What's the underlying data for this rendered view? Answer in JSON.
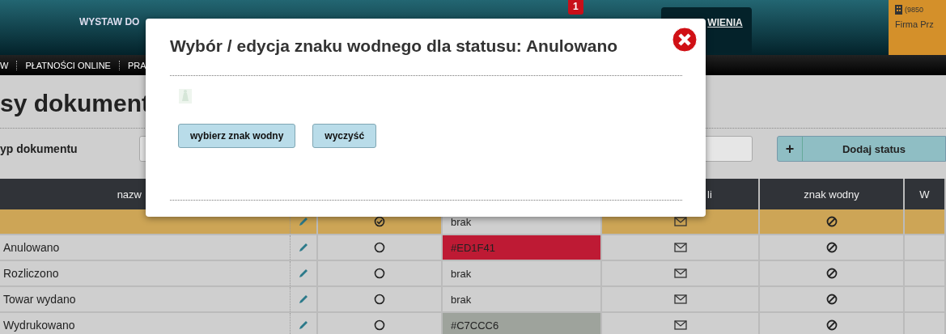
{
  "header": {
    "menu_item": "WYSTAW DO",
    "badge": "1",
    "active_link": "WIENIA",
    "account": {
      "phone": "(9850",
      "company": "Firma Prz"
    }
  },
  "nav": [
    {
      "label": "W"
    },
    {
      "label": "PŁATNOŚCI ONLINE"
    },
    {
      "label": "PRA"
    }
  ],
  "page": {
    "title": "sy dokument",
    "filter_label": "yp dokumentu",
    "add_button": {
      "icon": "+",
      "label": "Dodaj status"
    }
  },
  "table": {
    "columns": [
      {
        "kind": "text",
        "label": "nazw"
      },
      {
        "kind": "blank"
      },
      {
        "kind": "blank"
      },
      {
        "kind": "text",
        "label": "li"
      },
      {
        "kind": "text",
        "label": "znak wodny"
      },
      {
        "kind": "text",
        "label": "W"
      }
    ],
    "rows": [
      {
        "selected": true,
        "default": true,
        "color_label": "brak"
      },
      {
        "name": "Anulowano",
        "selected": false,
        "default": false,
        "color_label": "#ED1F41",
        "color": "#be1a34"
      },
      {
        "name": "Rozliczono",
        "selected": false,
        "default": false,
        "color_label": "brak"
      },
      {
        "name": "Towar wydano",
        "selected": false,
        "default": false,
        "color_label": "brak"
      },
      {
        "name": "Wydrukowano",
        "selected": false,
        "default": false,
        "color_label": "#C7CCC6",
        "color": "#9ea39c"
      }
    ]
  },
  "modal": {
    "title": "Wybór / edycja znaku wodnego dla statusu: Anulowano",
    "buttons": [
      "wybierz znak wodny",
      "wyczyść"
    ]
  }
}
